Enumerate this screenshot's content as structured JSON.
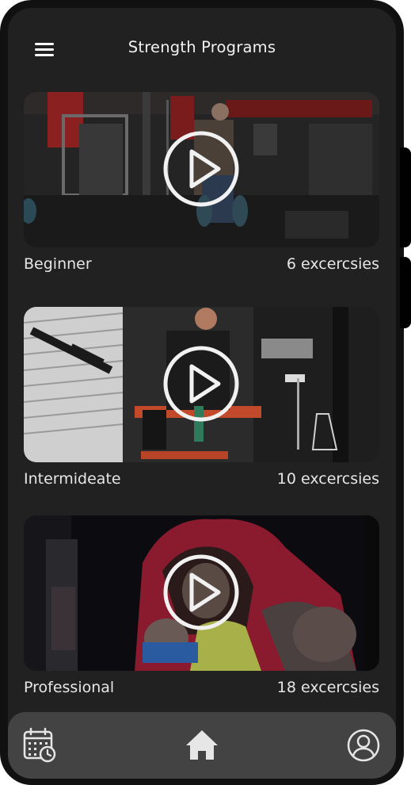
{
  "header": {
    "title": "Strength Programs",
    "menu_icon": "hamburger-menu-icon"
  },
  "programs": [
    {
      "name": "Beginner",
      "count": "6 excercsies",
      "play_icon": "play-icon"
    },
    {
      "name": "Intermideate",
      "count": "10 excercsies",
      "play_icon": "play-icon"
    },
    {
      "name": "Professional",
      "count": "18 excercsies",
      "play_icon": "play-icon"
    }
  ],
  "nav": {
    "items": [
      {
        "icon": "calendar-clock-icon"
      },
      {
        "icon": "home-icon"
      },
      {
        "icon": "user-profile-icon"
      }
    ]
  },
  "colors": {
    "frame": "#111111",
    "screen": "#212121",
    "nav_bar": "#434343",
    "text": "#f1f1f1"
  }
}
